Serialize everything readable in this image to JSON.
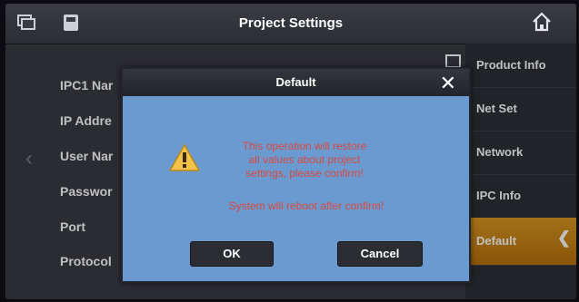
{
  "header": {
    "title": "Project Settings"
  },
  "left_fields": [
    "IPC1 Nar",
    "IP Addre",
    "User Nar",
    "Passwor",
    "Port",
    "Protocol"
  ],
  "right_menu": [
    {
      "label": "Product Info"
    },
    {
      "label": "Net Set"
    },
    {
      "label": "Network"
    },
    {
      "label": "IPC Info"
    },
    {
      "label": "Default",
      "active": true
    }
  ],
  "dialog": {
    "title": "Default",
    "message_lines": [
      "This operation will restore",
      "all values about project",
      "settings, please confirm!"
    ],
    "reboot_note": "System will reboot after confirm!",
    "ok_label": "OK",
    "cancel_label": "Cancel",
    "message_color": "#d94a3f",
    "warning_icon": "warning-triangle-icon"
  },
  "colors": {
    "accent_active": "#d0891a",
    "dialog_body": "#6b9ad0",
    "background": "#3a3a43"
  }
}
